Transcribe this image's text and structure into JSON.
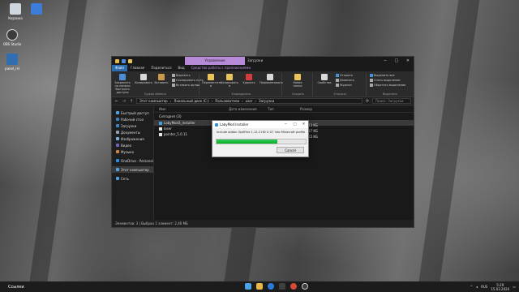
{
  "desktop": {
    "icons": [
      {
        "label": "Корзина",
        "color": "#d0d6de"
      },
      {
        "label": "",
        "color": "#3b7dd8"
      },
      {
        "label": "OBS Studio",
        "color": "#3c3c3c"
      },
      {
        "label": "panel_rsl",
        "color": "#2f6fb0"
      }
    ]
  },
  "explorer": {
    "context_tab": "Управление",
    "window_title": "Загрузки",
    "menu": [
      "Файл",
      "Главная",
      "Поделиться",
      "Вид",
      "Средства работы с приложениями"
    ],
    "ribbon": {
      "clipboard": {
        "group_label": "Буфер обмена",
        "pin": "Закрепить на панели быстрого доступа",
        "copy": "Копировать",
        "paste": "Вставить",
        "cut": "Вырезать",
        "copy_path": "Скопировать путь",
        "paste_shortcut": "Вставить ярлык"
      },
      "organize": {
        "group_label": "Упорядочить",
        "move_to": "Переместить в",
        "copy_to": "Копировать в",
        "delete": "Удалить",
        "rename": "Переименовать"
      },
      "create": {
        "group_label": "Создать",
        "new_folder": "Новая папка"
      },
      "open": {
        "group_label": "Открыть",
        "properties": "Свойства",
        "open": "Открыть",
        "edit": "Изменить",
        "history": "Журнал"
      },
      "select": {
        "group_label": "Выделить",
        "select_all": "Выделить все",
        "select_none": "Снять выделение",
        "invert": "Обратить выделение"
      }
    },
    "address": [
      "Этот компьютер",
      "Локальный диск (C:)",
      "Пользователи",
      "user",
      "Загрузки"
    ],
    "search_placeholder": "Поиск: Загрузки",
    "nav": [
      {
        "label": "Быстрый доступ",
        "color": "#4aa3e8"
      },
      {
        "label": "Рабочий стол",
        "color": "#3b82c4"
      },
      {
        "label": "Загрузки",
        "color": "#3b82c4"
      },
      {
        "label": "Документы",
        "color": "#8ea3b8"
      },
      {
        "label": "Изображения",
        "color": "#7db0d8"
      },
      {
        "label": "Видео",
        "color": "#7a5fc4"
      },
      {
        "label": "Музыка",
        "color": "#d2823c"
      },
      {
        "label": "OneDrive - Personal",
        "color": "#2a8ce0"
      },
      {
        "label": "Этот компьютер",
        "color": "#4aa3e8"
      },
      {
        "label": "Сеть",
        "color": "#4aa3e8"
      }
    ],
    "columns": [
      "Имя",
      "Дата изменения",
      "Тип",
      "Размер"
    ],
    "group_today": "Сегодня (3)",
    "files": [
      {
        "name": "LabyMod3_Installer",
        "size": "143 КБ",
        "selected": true,
        "color": "#3fa0e0"
      },
      {
        "name": "Ioser",
        "size": "87 КБ",
        "selected": false,
        "color": "#e8e8e8"
      },
      {
        "name": "pointer_5.0.11",
        "size": "165 КБ",
        "selected": false,
        "color": "#e8e8e8"
      }
    ],
    "status": "Элементов: 3   |   Выбран 1 элемент: 2,40 МБ"
  },
  "installer": {
    "title": "LabyMod Installer",
    "message": "Include addon OptiFine 1.12.2 HD U G7 into Minecraft profile",
    "progress": 0.68,
    "cancel": "Cancel"
  },
  "taskbar": {
    "search": "Ссылки",
    "lang": "RUS",
    "time": "5:29",
    "date": "15.03.2024",
    "app_colors": [
      "#4aa3e8",
      "#e8b84a",
      "#2a7be0",
      "#3f3f3f",
      "#d64a3c",
      "#3c3c3c"
    ]
  }
}
